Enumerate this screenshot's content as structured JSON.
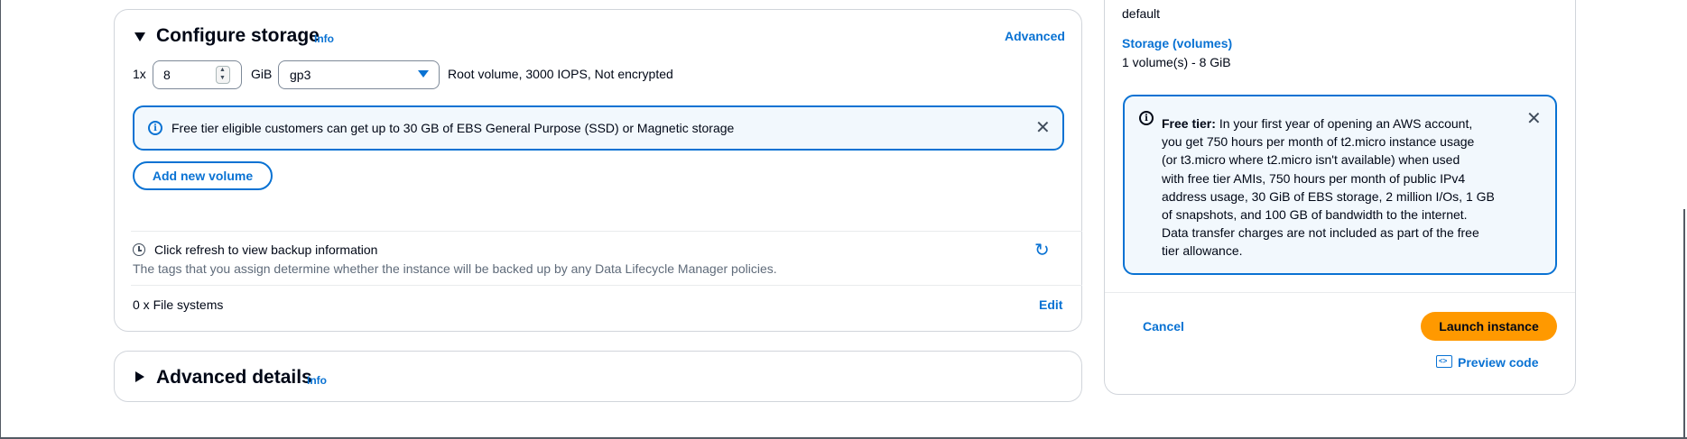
{
  "storage": {
    "title": "Configure storage",
    "info": "Info",
    "advanced_link": "Advanced",
    "volume": {
      "multiplier": "1x",
      "size_value": "8",
      "unit": "GiB",
      "type_value": "gp3",
      "description": "Root volume,  3000 IOPS,  Not encrypted"
    },
    "free_tier_alert": "Free tier eligible customers can get up to 30 GB of EBS General Purpose (SSD) or Magnetic storage",
    "add_volume_button": "Add new volume",
    "backup": {
      "title": "Click refresh to view backup information",
      "description": "The tags that you assign determine whether the instance will be backed up by any Data Lifecycle Manager policies."
    },
    "file_systems": {
      "label": "0 x File systems",
      "edit": "Edit"
    }
  },
  "advanced_details": {
    "title": "Advanced details",
    "info": "Info"
  },
  "summary": {
    "security_group_value": "default",
    "storage_label": "Storage (volumes)",
    "storage_value": "1 volume(s) - 8 GiB",
    "free_tier": {
      "lead": "Free tier:",
      "lines": [
        "In your first year of opening an AWS account,",
        "you get 750 hours per month of t2.micro instance usage",
        "(or t3.micro where t2.micro isn't available) when used",
        "with free tier AMIs, 750 hours per month of public IPv4",
        "address usage, 30 GiB of EBS storage, 2 million I/Os, 1 GB",
        "of snapshots, and 100 GB of bandwidth to the internet.",
        "Data transfer charges are not included as part of the free",
        "tier allowance."
      ]
    },
    "cancel_button": "Cancel",
    "launch_button": "Launch instance",
    "preview_code": "Preview code"
  }
}
